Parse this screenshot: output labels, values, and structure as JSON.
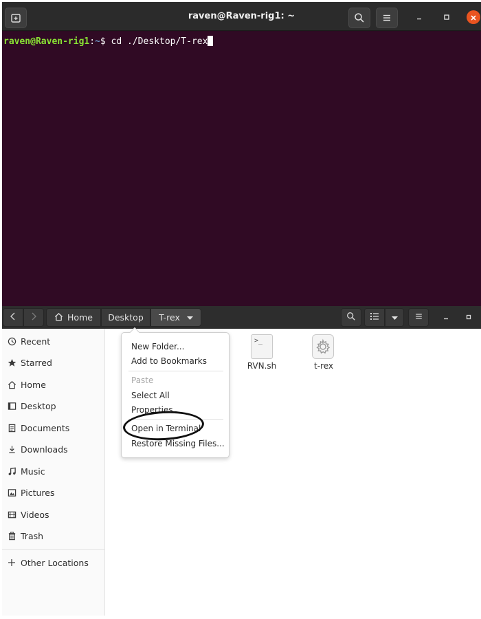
{
  "terminal": {
    "title": "raven@Raven-rig1: ~",
    "prompt_user": "raven@Raven-rig1",
    "prompt_colon": ":",
    "prompt_path": "~",
    "prompt_symbol": "$ ",
    "command": "cd ./Desktop/T-rex",
    "colors": {
      "background": "#300a24",
      "user": "#8ae234",
      "path": "#729fcf",
      "close": "#e95420"
    }
  },
  "files": {
    "path_bar": [
      {
        "label": "Home",
        "icon": "home-icon"
      },
      {
        "label": "Desktop"
      },
      {
        "label": "T-rex",
        "current": true
      }
    ],
    "sidebar": {
      "items": [
        {
          "label": "Recent",
          "icon": "clock-icon"
        },
        {
          "label": "Starred",
          "icon": "star-icon"
        },
        {
          "label": "Home",
          "icon": "home-icon"
        },
        {
          "label": "Desktop",
          "icon": "desktop-icon"
        },
        {
          "label": "Documents",
          "icon": "document-icon"
        },
        {
          "label": "Downloads",
          "icon": "download-icon"
        },
        {
          "label": "Music",
          "icon": "music-icon"
        },
        {
          "label": "Pictures",
          "icon": "picture-icon"
        },
        {
          "label": "Videos",
          "icon": "video-icon"
        },
        {
          "label": "Trash",
          "icon": "trash-icon"
        }
      ],
      "other": {
        "label": "Other Locations",
        "icon": "plus-icon"
      }
    },
    "files": [
      {
        "name": "RVN.sh",
        "icon": "script-file-icon",
        "glyph": ">_"
      },
      {
        "name": "t-rex",
        "icon": "executable-gear-icon"
      }
    ]
  },
  "context_menu": {
    "items": [
      {
        "label": "New Folder..."
      },
      {
        "label": "Add to Bookmarks"
      },
      {
        "label": "Paste",
        "disabled": true
      },
      {
        "label": "Select All"
      },
      {
        "label": "Properties"
      },
      {
        "label": "Open in Terminal",
        "highlighted": true
      },
      {
        "label": "Restore Missing Files..."
      }
    ]
  }
}
